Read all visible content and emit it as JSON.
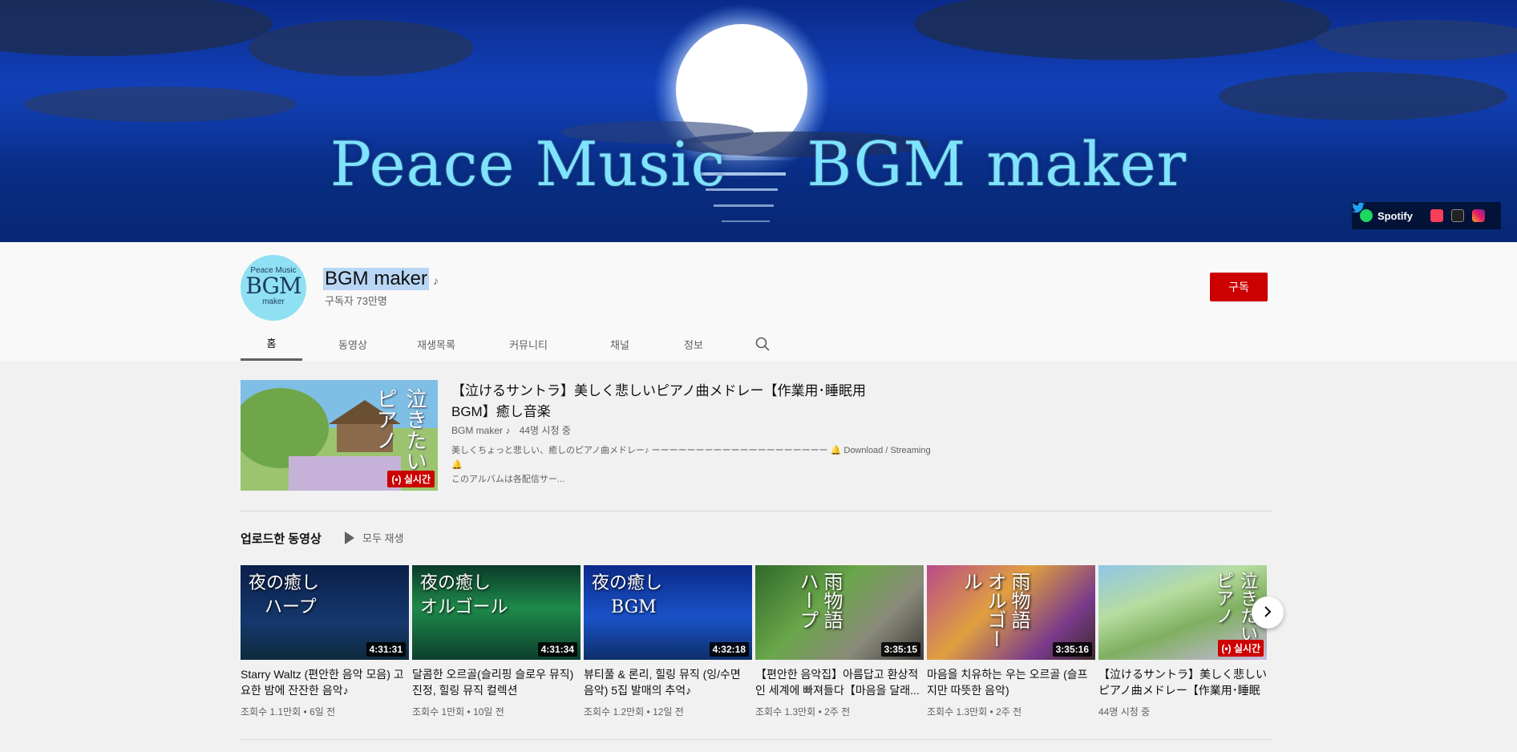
{
  "banner": {
    "title_left": "Peace Music",
    "title_right": "BGM maker",
    "links": {
      "spotify": "Spotify"
    }
  },
  "channel": {
    "avatar_line1": "Peace Music",
    "avatar_line2": "BGM",
    "avatar_line3": "maker",
    "name": "BGM maker",
    "name_icon": "♪",
    "subscribers": "구독자 73만명",
    "subscribe_label": "구독"
  },
  "tabs": [
    {
      "label": "홈",
      "active": true
    },
    {
      "label": "동영상"
    },
    {
      "label": "재생목록"
    },
    {
      "label": "커뮤니티"
    },
    {
      "label": "채널"
    },
    {
      "label": "정보"
    }
  ],
  "featured": {
    "thumb_text": "泣きたいピアノ",
    "badge": "(•) 실시간",
    "title": "【泣けるサントラ】美しく悲しいピアノ曲メドレー【作業用･睡眠用BGM】癒し音楽",
    "channel": "BGM maker",
    "channel_icon": "♪",
    "viewers": "44명 시청 중",
    "desc_line1": "美しくちょっと悲しい、癒しのピアノ曲メドレー♪ ーーーーーーーーーーーーーーーーーーーー 🔔 Download / Streaming 🔔",
    "desc_line2": "このアルバムは各配信サー..."
  },
  "uploads": {
    "title": "업로드한 동영상",
    "play_all": "모두 재생",
    "videos": [
      {
        "thumb_line1": "夜の癒し",
        "thumb_line2": "ハープ",
        "duration": "4:31:31",
        "title": "Starry Waltz (편안한 음악 모음) 고요한 밤에 잔잔한 음악♪",
        "meta": "조회수 1.1만회 • 6일 전"
      },
      {
        "thumb_line1": "夜の癒し",
        "thumb_line2": "オルゴール",
        "duration": "4:31:34",
        "title": "달콤한 오르골(슬리핑 슬로우 뮤직)진정, 힐링 뮤직 컬렉션",
        "meta": "조회수 1만회 • 10일 전"
      },
      {
        "thumb_line1": "夜の癒し",
        "thumb_line2": "BGM",
        "duration": "4:32:18",
        "title": "뷰티풀 & 론리, 힐링 뮤직 (잉/수면 음악) 5집 발매의 추억♪",
        "meta": "조회수 1.2만회 • 12일 전"
      },
      {
        "thumb_line1": "雨物語",
        "thumb_line2": "ハープ",
        "duration": "3:35:15",
        "title": "【편안한 음악집】아름답고 환상적인 세계에 빠져들다【마음을 달래...",
        "meta": "조회수 1.3만회 • 2주 전"
      },
      {
        "thumb_line1": "雨物語",
        "thumb_line2": "オルゴール",
        "duration": "3:35:16",
        "title": "마음을 치유하는 우는 오르골 (슬프지만 따뜻한 음악)",
        "meta": "조회수 1.3만회 • 2주 전"
      },
      {
        "thumb_line1": "泣きたい",
        "thumb_line2": "ピアノ",
        "duration": "(•) 실시간",
        "title": "【泣けるサントラ】美しく悲しいピアノ曲メドレー【作業用･睡眠用...",
        "meta": "44명 시청 중"
      }
    ]
  },
  "colors": {
    "subscribe": "#cc0000",
    "live": "#cc0000",
    "banner_text": "#7fe3ff"
  }
}
